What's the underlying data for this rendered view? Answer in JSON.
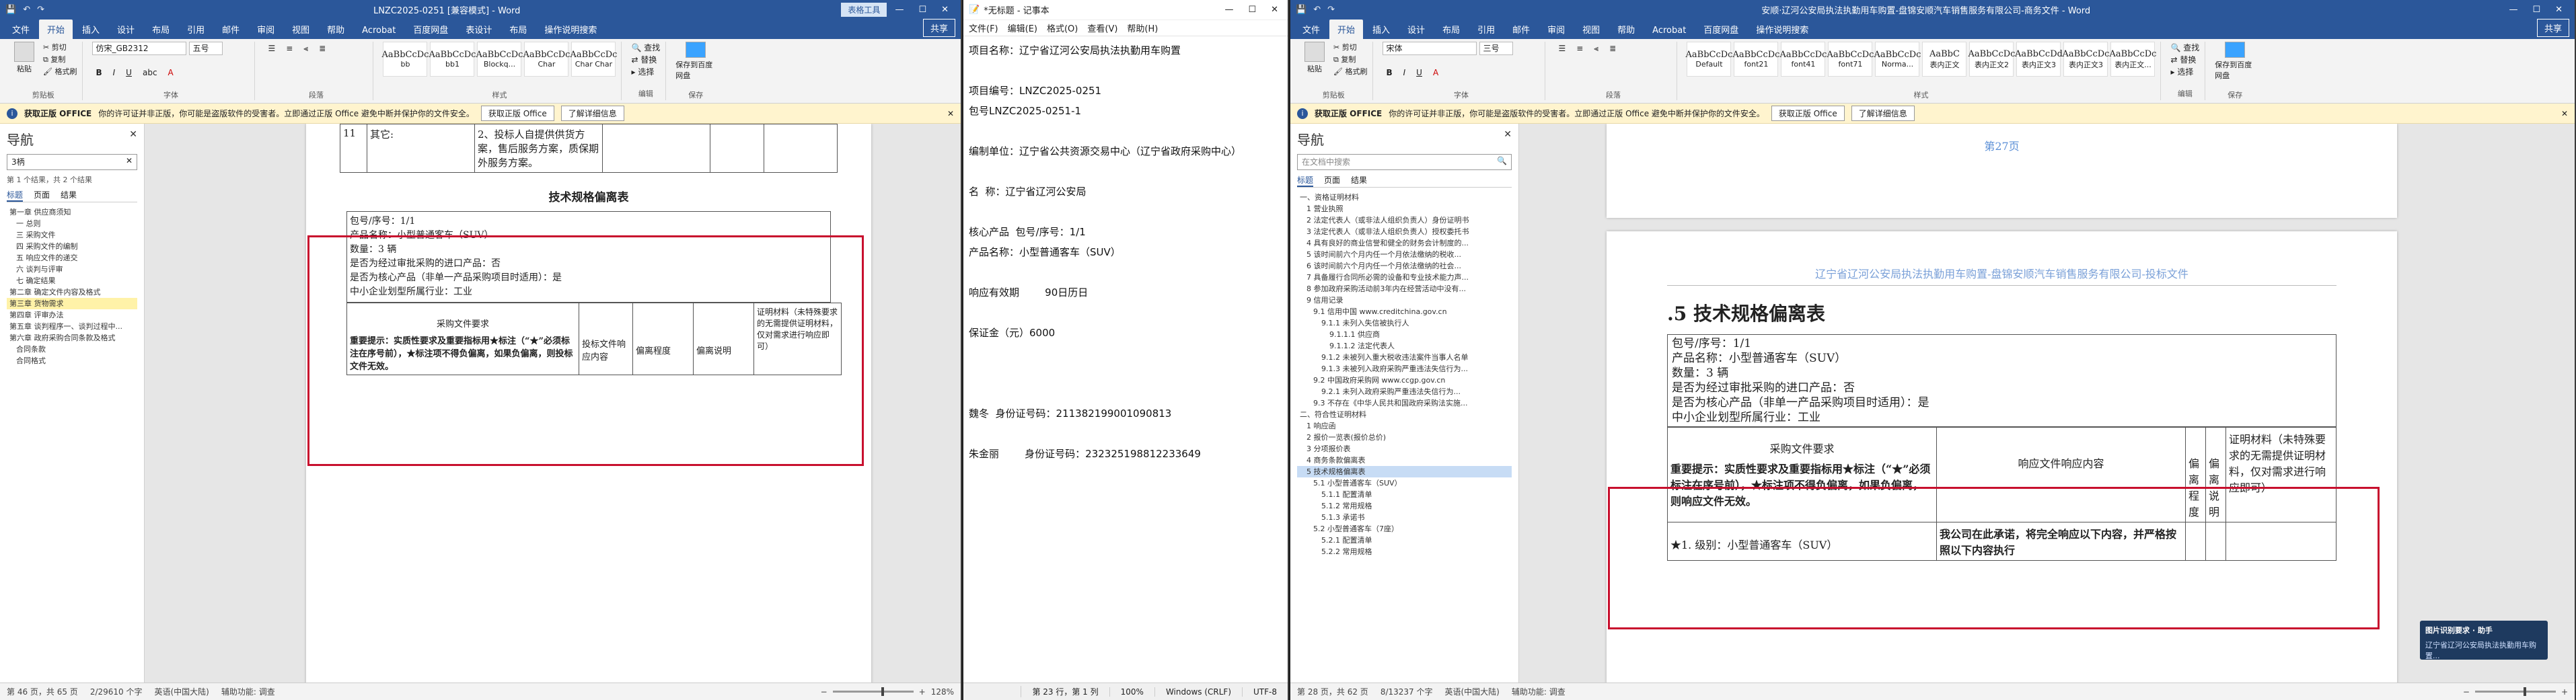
{
  "left_word": {
    "title": "LNZC2025-0251 [兼容模式] - Word",
    "context_tab": "表格工具",
    "tabs": [
      "文件",
      "开始",
      "插入",
      "设计",
      "布局",
      "引用",
      "邮件",
      "审阅",
      "视图",
      "帮助",
      "Acrobat",
      "百度网盘",
      "表设计",
      "布局"
    ],
    "tell_me": "操作说明搜索",
    "share": "共享",
    "clipboard": {
      "paste": "粘贴",
      "cut": "剪切",
      "copy": "复制",
      "format_painter": "格式刷",
      "label": "剪贴板"
    },
    "font": {
      "name": "仿宋_GB2312",
      "size": "五号",
      "label": "字体"
    },
    "paragraph_label": "段落",
    "styles": [
      {
        "preview": "AaBbCcDc",
        "name": "bb"
      },
      {
        "preview": "AaBbCcDc",
        "name": "bb1"
      },
      {
        "preview": "AaBbCcDc",
        "name": "Blockq..."
      },
      {
        "preview": "AaBbCcDc",
        "name": "Char"
      },
      {
        "preview": "AaBbCcDc",
        "name": "Char Char"
      }
    ],
    "styles_label": "样式",
    "editing": {
      "find": "查找",
      "replace": "替换",
      "select": "选择",
      "label": "编辑"
    },
    "save_baidu": "保存到百度网盘",
    "save_label": "保存",
    "info": {
      "brand": "获取正版 OFFICE",
      "message": "你的许可证并非正版，你可能是盗版软件的受害者。立即通过正版 Office 避免中断并保护你的文件安全。",
      "btn1": "获取正版 Office",
      "btn2": "了解详细信息"
    },
    "nav": {
      "title": "导航",
      "search": "3柄",
      "result": "第 1 个结果，共 2 个结果",
      "tabs": [
        "标题",
        "页面",
        "结果"
      ],
      "items": [
        "第一章 供应商须知",
        "一 总则",
        "三 采购文件",
        "四 采购文件的编制",
        "五 响应文件的递交",
        "六 谈判与评审",
        "七 确定结果",
        "第二章 确定文件内容及格式",
        "第三章 货物需求",
        "第四章 评审办法",
        "第五章 谈判程序一、谈判过程中...",
        "第六章 政府采购合同条款及格式",
        "合同条款",
        "合同格式"
      ]
    },
    "doc": {
      "row11_no": "11",
      "row11_label": "其它:",
      "row11_text": "2、投标人自提供供货方案，售后服务方案，质保期外服务方案。",
      "heading": "技术规格偏离表",
      "lines": [
        "包号/序号：1/1",
        "产品名称：小型普通客车（SUV）",
        "数量：3 辆",
        "是否为经过审批采购的进口产品：否",
        "是否为核心产品（非单一产品采购项目时适用）：是",
        "中小企业划型所属行业：工业"
      ],
      "req_title": "采购文件要求",
      "req_text": "重要提示：实质性要求及重要指标用★标注（“★”必须标注在序号前），★标注项不得负偏离，如果负偏离，则投标文件无效。",
      "col_resp": "投标文件响应内容",
      "col_dev": "偏离程度",
      "col_note": "偏离说明",
      "col_proof": "证明材料（未特殊要求的无需提供证明材料，仅对需求进行响应即可）"
    },
    "status": {
      "page": "第 46 页，共 65 页",
      "words": "2/29610 个字",
      "lang": "英语(中国大陆)",
      "accessibility": "辅助功能: 调查",
      "zoom": "128%"
    }
  },
  "notepad": {
    "title": "*无标题 - 记事本",
    "menu": [
      "文件(F)",
      "编辑(E)",
      "格式(O)",
      "查看(V)",
      "帮助(H)"
    ],
    "lines": [
      "项目名称：辽宁省辽河公安局执法执勤用车购置",
      "",
      "项目编号：LNZC2025-0251",
      "包号LNZC2025-0251-1",
      "",
      "编制单位：辽宁省公共资源交易中心（辽宁省政府采购中心）",
      "",
      "名  称：辽宁省辽河公安局",
      "",
      "核心产品  包号/序号：1/1",
      "产品名称：小型普通客车（SUV）",
      "",
      "响应有效期        90日历日",
      "",
      "保证金（元）6000",
      "",
      "",
      "",
      "魏冬  身份证号码：211382199001090813",
      "",
      "朱金丽        身份证号码：232325198812233649"
    ],
    "status": {
      "pos": "第 23 行，第 1 列",
      "zoom": "100%",
      "eol": "Windows (CRLF)",
      "enc": "UTF-8"
    }
  },
  "right_word": {
    "title": "安顺·辽河公安局执法执勤用车购置-盘锦安顺汽车销售服务有限公司-商务文件 - Word",
    "tabs": [
      "文件",
      "开始",
      "插入",
      "设计",
      "布局",
      "引用",
      "邮件",
      "审阅",
      "视图",
      "帮助",
      "Acrobat",
      "百度网盘"
    ],
    "tell_me": "操作说明搜索",
    "share": "共享",
    "font": {
      "name": "宋体",
      "size": "三号"
    },
    "styles": [
      {
        "preview": "AaBbCcDc",
        "name": "Default"
      },
      {
        "preview": "AaBbCcDc",
        "name": "font21"
      },
      {
        "preview": "AaBbCcDc",
        "name": "font41"
      },
      {
        "preview": "AaBbCcDc",
        "name": "font71"
      },
      {
        "preview": "AaBbCcDc",
        "name": "Norma..."
      },
      {
        "preview": "AaBbC",
        "name": "表内正文"
      },
      {
        "preview": "AaBbCcDc",
        "name": "表内正文2"
      },
      {
        "preview": "AaBbCcDd",
        "name": "表内正文3"
      },
      {
        "preview": "AaBbCcDc",
        "name": "表内正文3"
      },
      {
        "preview": "AaBbCcDc",
        "name": "表内正文..."
      }
    ],
    "info": {
      "brand": "获取正版 OFFICE",
      "message": "你的许可证并非正版，你可能是盗版软件的受害者。立即通过正版 Office 避免中断并保护你的文件安全。",
      "btn1": "获取正版 Office",
      "btn2": "了解详细信息"
    },
    "nav": {
      "title": "导航",
      "search": "在文档中搜索",
      "tabs": [
        "标题",
        "页面",
        "结果"
      ],
      "items": [
        "一、资格证明材料",
        "1 营业执照",
        "2 法定代表人（或非法人组织负责人）身份证明书",
        "3 法定代表人（或非法人组织负责人）授权委托书",
        "4 具有良好的商业信誉和健全的财务会计制度的...",
        "5 该时间前六个月内任一个月依法缴纳的税收...",
        "6 该时间前六个月内任一个月依法缴纳的社会...",
        "7 具备履行合同所必需的设备和专业技术能力声...",
        "8 参加政府采购活动前3年内在经营活动中没有...",
        "9 信用记录",
        "9.1 信用中国 www.creditchina.gov.cn",
        "9.1.1 未列入失信被执行人",
        "9.1.1.1 供应商",
        "9.1.1.2 法定代表人",
        "9.1.2 未被列入重大税收违法案件当事人名单",
        "9.1.3 未被列入政府采购严重违法失信行为...",
        "9.2 中国政府采购网 www.ccgp.gov.cn",
        "9.2.1 未列入政府采购严重违法失信行为...",
        "9.3 不存在《中华人民共和国政府采购法实施...",
        "二、符合性证明材料",
        "1 响应函",
        "2 报价一览表(报价总价)",
        "3 分项报价表",
        "4 商务条款偏离表",
        "5 技术规格偏离表",
        "5.1 小型普通客车（SUV）",
        "5.1.1 配置清单",
        "5.1.2 常用规格",
        "5.1.3 承诺书",
        "5.2 小型普通客车（7座）",
        "5.2.1 配置清单",
        "5.2.2 常用规格"
      ]
    },
    "doc": {
      "page_footer": "第27页",
      "header": "辽宁省辽河公安局执法执勤用车购置-盘锦安顺汽车销售服务有限公司-投标文件",
      "heading": ".5 技术规格偏离表",
      "lines": [
        "包号/序号：1/1",
        "产品名称：小型普通客车（SUV）",
        "数量：3 辆",
        "是否为经过审批采购的进口产品：否",
        "是否为核心产品（非单一产品采购项目时适用）：是",
        "中小企业划型所属行业：工业"
      ],
      "req_title": "采购文件要求",
      "req_text": "重要提示：实质性要求及重要指标用★标注（“★”必须标注在序号前），★标注项不得负偏离，如果负偏离，则响应文件无效。",
      "col_resp": "响应文件响应内容",
      "col_dev": "偏离程度",
      "col_note": "偏离说明",
      "col_proof": "证明材料（未特殊要求的无需提供证明材料，仅对需求进行响应即可）",
      "row1_req": "★1. 级别：小型普通客车（SUV）",
      "row1_resp": "我公司在此承诺，将完全响应以下内容，并严格按照以下内容执行"
    },
    "status": {
      "page": "第 28 页，共 62 页",
      "words": "8/13237 个字",
      "lang": "英语(中国大陆)",
      "accessibility": "辅助功能: 调查"
    },
    "toast": {
      "title": "图片识别要求 · 助手",
      "text": "辽宁省辽河公安局执法执勤用车购置..."
    }
  }
}
